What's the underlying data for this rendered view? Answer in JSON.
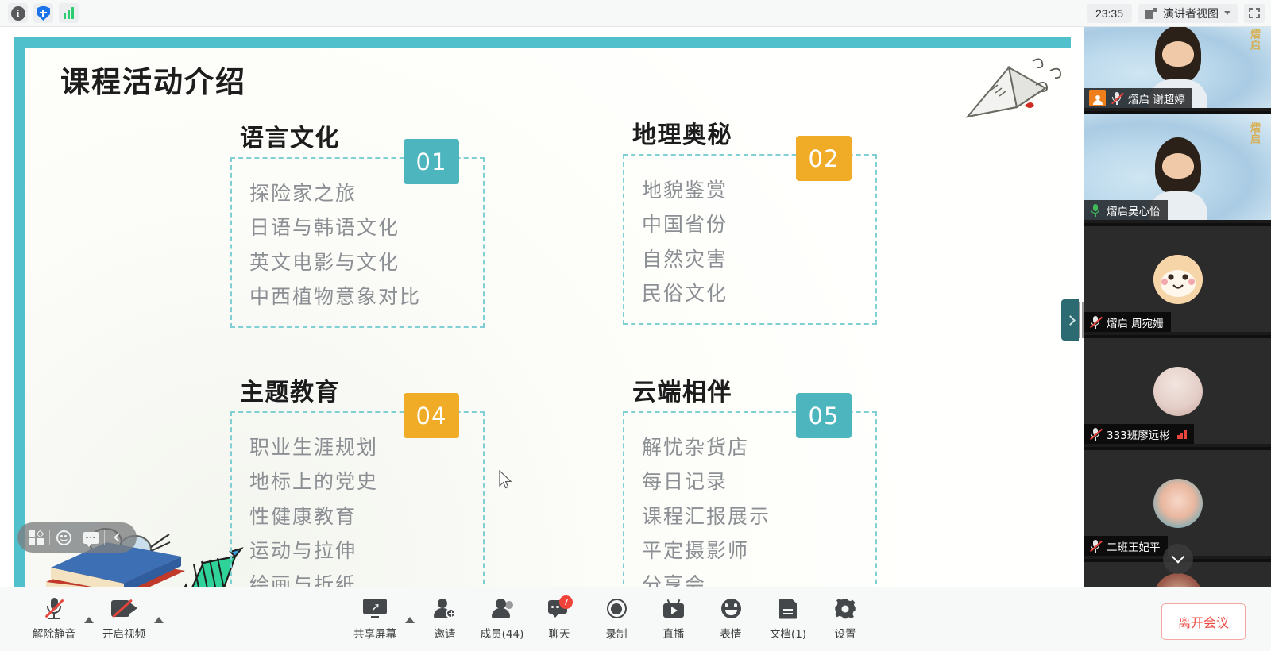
{
  "topbar": {
    "icons": [
      {
        "name": "info-icon",
        "glyph": "i"
      },
      {
        "name": "shield-plus-icon",
        "glyph": "+"
      },
      {
        "name": "network-bars-icon",
        "glyph": "bars"
      }
    ],
    "clock": "23:35",
    "view_mode": "演讲者视图",
    "fullscreen_label": "全屏"
  },
  "slide": {
    "title": "课程活动介绍",
    "sections": [
      {
        "heading": "语言文化",
        "badge": "01",
        "badge_color": "#4cb5bd",
        "items": [
          "探险家之旅",
          "日语与韩语文化",
          "英文电影与文化",
          "中西植物意象对比"
        ]
      },
      {
        "heading": "地理奥秘",
        "badge": "02",
        "badge_color": "#f0ab27",
        "items": [
          "地貌鉴赏",
          "中国省份",
          "自然灾害",
          "民俗文化"
        ]
      },
      {
        "heading": "主题教育",
        "badge": "04",
        "badge_color": "#f0ab27",
        "items": [
          "职业生涯规划",
          "地标上的党史",
          "性健康教育",
          "运动与拉伸",
          "绘画与折纸"
        ]
      },
      {
        "heading": "云端相伴",
        "badge": "05",
        "badge_color": "#4cb5bd",
        "items": [
          "解忧杂货店",
          "每日记录",
          "课程汇报展示",
          "平定摄影师",
          "分享会"
        ]
      }
    ],
    "border_color": "#4fc0cc",
    "dash_color": "#7fd0d4"
  },
  "annotation_bar": {
    "buttons": [
      "shapes-icon",
      "emoji-icon",
      "comment-icon",
      "collapse-left-icon"
    ]
  },
  "video_panel": {
    "tiles": [
      {
        "name": "熠启 谢超婷",
        "muted": true,
        "host": true,
        "speaking": false,
        "avatar": "video",
        "signal": false
      },
      {
        "name": "熠启吴心怡",
        "muted": false,
        "host": false,
        "speaking": true,
        "avatar": "video",
        "signal": false
      },
      {
        "name": "熠启 周宛姗",
        "muted": true,
        "host": false,
        "speaking": false,
        "avatar": "bunny",
        "signal": false
      },
      {
        "name": "333班廖远彬",
        "muted": true,
        "host": false,
        "speaking": false,
        "avatar": "photo-soft",
        "signal": true
      },
      {
        "name": "二班王妃平",
        "muted": true,
        "host": false,
        "speaking": false,
        "avatar": "photo-blue",
        "signal": false
      },
      {
        "name": "",
        "muted": false,
        "host": false,
        "speaking": false,
        "avatar": "photo-red",
        "signal": false
      }
    ],
    "scroll_down_label": "向下滚动"
  },
  "toolbar": {
    "items": [
      {
        "name": "unmute-button",
        "label": "解除静音",
        "icon": "mic-muted-icon",
        "has_caret": true,
        "badge": null
      },
      {
        "name": "start-video-button",
        "label": "开启视频",
        "icon": "camera-off-icon",
        "has_caret": true,
        "badge": null
      },
      {
        "name": "share-screen-button",
        "label": "共享屏幕",
        "icon": "share-screen-icon",
        "has_caret": true,
        "badge": null
      },
      {
        "name": "invite-button",
        "label": "邀请",
        "icon": "invite-user-icon",
        "has_caret": false,
        "badge": null
      },
      {
        "name": "participants-button",
        "label": "成员(44)",
        "icon": "participants-icon",
        "has_caret": false,
        "badge": null
      },
      {
        "name": "chat-button",
        "label": "聊天",
        "icon": "chat-icon",
        "has_caret": false,
        "badge": "7"
      },
      {
        "name": "record-button",
        "label": "录制",
        "icon": "record-icon",
        "has_caret": false,
        "badge": null
      },
      {
        "name": "live-button",
        "label": "直播",
        "icon": "live-icon",
        "has_caret": false,
        "badge": null
      },
      {
        "name": "reactions-button",
        "label": "表情",
        "icon": "emoji-icon",
        "has_caret": false,
        "badge": null
      },
      {
        "name": "documents-button",
        "label": "文档(1)",
        "icon": "document-icon",
        "has_caret": false,
        "badge": null
      },
      {
        "name": "settings-button",
        "label": "设置",
        "icon": "gear-icon",
        "has_caret": false,
        "badge": null
      }
    ],
    "leave_label": "离开会议",
    "leave_color": "#ea4b43"
  }
}
